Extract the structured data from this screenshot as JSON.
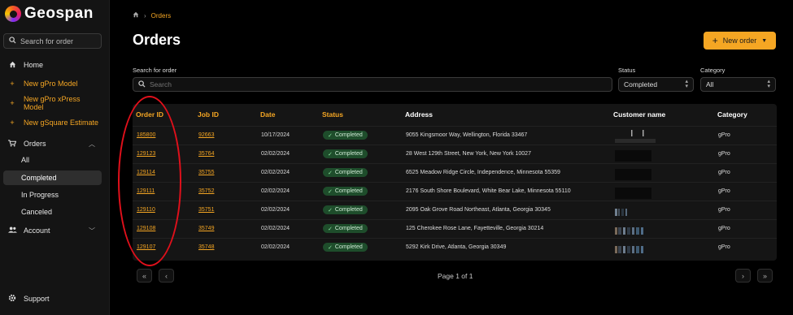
{
  "brand": {
    "name": "Geospan"
  },
  "sidebar": {
    "search_placeholder": "Search for order",
    "items": [
      {
        "label": "Home",
        "icon": "home-icon"
      },
      {
        "label": "New gPro Model",
        "icon": "plus-icon"
      },
      {
        "label": "New gPro xPress Model",
        "icon": "plus-icon"
      },
      {
        "label": "New gSquare Estimate",
        "icon": "plus-icon"
      },
      {
        "label": "Orders",
        "icon": "cart-icon"
      },
      {
        "label": "All"
      },
      {
        "label": "Completed"
      },
      {
        "label": "In Progress"
      },
      {
        "label": "Canceled"
      },
      {
        "label": "Account",
        "icon": "people-icon"
      },
      {
        "label": "Support",
        "icon": "gear-icon"
      }
    ]
  },
  "breadcrumb": {
    "current": "Orders"
  },
  "page": {
    "title": "Orders",
    "new_order_label": "New order"
  },
  "filters": {
    "search_label": "Search for order",
    "search_placeholder": "Search",
    "status_label": "Status",
    "status_value": "Completed",
    "category_label": "Category",
    "category_value": "All"
  },
  "table": {
    "columns": [
      "Order ID",
      "Job ID",
      "Date",
      "Status",
      "Address",
      "Customer name",
      "Category"
    ],
    "rows": [
      {
        "order_id": "185800",
        "job_id": "92663",
        "date": "10/17/2024",
        "status": "Completed",
        "address": "9055 Kingsmoor Way, Wellington, Florida 33467",
        "category": "gPro"
      },
      {
        "order_id": "129123",
        "job_id": "35764",
        "date": "02/02/2024",
        "status": "Completed",
        "address": "28 West 129th Street, New York, New York 10027",
        "category": "gPro"
      },
      {
        "order_id": "129114",
        "job_id": "35755",
        "date": "02/02/2024",
        "status": "Completed",
        "address": "6525 Meadow Ridge Circle, Independence, Minnesota 55359",
        "category": "gPro"
      },
      {
        "order_id": "129111",
        "job_id": "35752",
        "date": "02/02/2024",
        "status": "Completed",
        "address": "2176 South Shore Boulevard, White Bear Lake, Minnesota 55110",
        "category": "gPro"
      },
      {
        "order_id": "129110",
        "job_id": "35751",
        "date": "02/02/2024",
        "status": "Completed",
        "address": "2095 Oak Grove Road Northeast, Atlanta, Georgia 30345",
        "category": "gPro"
      },
      {
        "order_id": "129108",
        "job_id": "35749",
        "date": "02/02/2024",
        "status": "Completed",
        "address": "125 Cherokee Rose Lane, Fayetteville, Georgia 30214",
        "category": "gPro"
      },
      {
        "order_id": "129107",
        "job_id": "35748",
        "date": "02/02/2024",
        "status": "Completed",
        "address": "5292 Kirk Drive, Atlanta, Georgia 30349",
        "category": "gPro"
      }
    ]
  },
  "pagination": {
    "text": "Page 1 of 1"
  },
  "colors": {
    "accent": "#f5a623",
    "status_bg": "#1e4d2b",
    "annotation": "#e0101b"
  }
}
